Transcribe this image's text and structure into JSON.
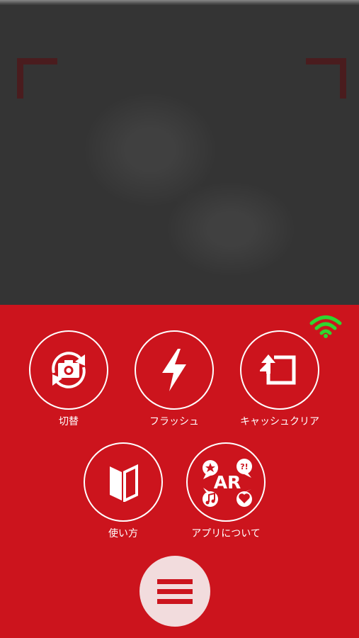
{
  "buttons": {
    "switch": {
      "label": "切替",
      "icon": "camera-switch-icon"
    },
    "flash": {
      "label": "フラッシュ",
      "icon": "lightning-icon"
    },
    "cache_clear": {
      "label": "キャッシュクリア",
      "icon": "clear-cache-icon"
    },
    "how_to_use": {
      "label": "使い方",
      "icon": "beginner-mark-icon"
    },
    "about_app": {
      "label": "アプリについて",
      "icon": "ar-icon",
      "badge_text": "AR",
      "bubble_text": "?!"
    }
  },
  "menu": {
    "icon": "hamburger-menu-icon"
  },
  "status": {
    "signal_icon": "wifi-signal-icon",
    "signal_color": "#2fd62f"
  },
  "colors": {
    "accent": "#cc141d",
    "camera_bg": "#343434",
    "white": "#ffffff"
  }
}
